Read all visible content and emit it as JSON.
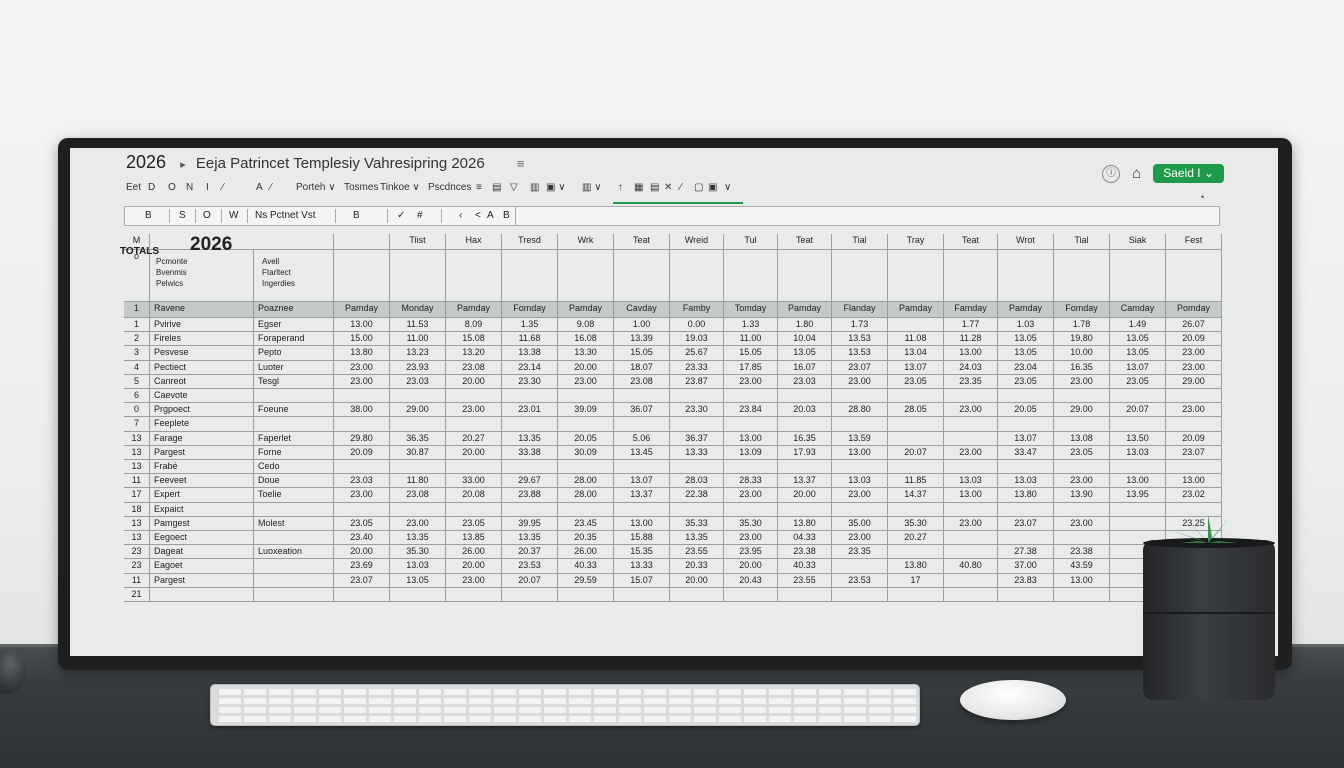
{
  "window": {
    "year": "2026",
    "title": "Eeja Patrincet Templesiy Vahresipring 2026",
    "menu_icon": "≡",
    "share_label": "Saeid I",
    "info_icon": "info-icon",
    "home_icon": "home-icon"
  },
  "ribbon": {
    "items": [
      "Eet",
      "D",
      "O",
      "N",
      "I",
      "⁄",
      "A",
      "⁄",
      "Porteh ∨",
      "Tosmes",
      "Tinkoe ∨",
      "Pscdnces",
      "≡",
      "▤",
      "▽",
      "▥",
      "▣ ∨",
      "▥ ∨",
      "↑",
      "▦",
      "▤",
      "✕",
      "⁄",
      "▢",
      "▣",
      "∨"
    ]
  },
  "formula_bar": {
    "items": [
      "fill",
      "B",
      "S",
      "O",
      "W",
      "Ns Pctnet Vst",
      "B",
      "✓",
      "#",
      "‹",
      "<",
      "A",
      "B"
    ],
    "cell_ref": "M"
  },
  "sheet": {
    "big_year": "2026",
    "totals_label": "TOTALS",
    "corner": "M",
    "row_o": "o",
    "top_headers": [
      "Tiist",
      "Hax",
      "Tresd",
      "Wrk",
      "Teat",
      "Wreid",
      "Tul",
      "Teat",
      "Tial",
      "Tray",
      "Teat",
      "Wrot",
      "Tial",
      "Siak",
      "Fest"
    ],
    "desc_col_a": [
      "Pcmonte",
      "Bvenmis",
      "Pelwics"
    ],
    "desc_col_b": [
      "Avell",
      "Ftarltect",
      "Ingerdies"
    ],
    "day_header": {
      "rn": "1",
      "a": "Ravene",
      "b": "Poaznee",
      "days": [
        "Pamday",
        "Monday",
        "Pamday",
        "Fomday",
        "Pamday",
        "Cavday",
        "Famby",
        "Tomday",
        "Pamday",
        "Flanday",
        "Pamday",
        "Famday",
        "Pamday",
        "Fomday",
        "Camday",
        "Pomday"
      ]
    },
    "rows": [
      {
        "rn": "1",
        "a": "Pvirive",
        "b": "Egser",
        "v": [
          "13.00",
          "11.53",
          "8.09",
          "1.35",
          "9.08",
          "1.00",
          "0.00",
          "1.33",
          "1.80",
          "1.73",
          "",
          "1.77",
          "1.03",
          "1.78",
          "1.49",
          "26.07"
        ]
      },
      {
        "rn": "2",
        "a": "Fireles",
        "b": "Foraperand",
        "v": [
          "15.00",
          "11.00",
          "15.08",
          "11.68",
          "16.08",
          "13.39",
          "19.03",
          "11.00",
          "10.04",
          "13.53",
          "11.08",
          "11.28",
          "13.05",
          "19.80",
          "13.05",
          "20.09"
        ]
      },
      {
        "rn": "3",
        "a": "Pesvese",
        "b": "Pepto",
        "v": [
          "13.80",
          "13.23",
          "13.20",
          "13.38",
          "13.30",
          "15.05",
          "25.67",
          "15.05",
          "13.05",
          "13.53",
          "13.04",
          "13.00",
          "13.05",
          "10.00",
          "13.05",
          "23.00"
        ]
      },
      {
        "rn": "4",
        "a": "Pectiect",
        "b": "Luoter",
        "v": [
          "23.00",
          "23.93",
          "23.08",
          "23.14",
          "20.00",
          "18.07",
          "23.33",
          "17.85",
          "16.07",
          "23.07",
          "13.07",
          "24.03",
          "23.04",
          "16.35",
          "13.07",
          "23.00"
        ]
      },
      {
        "rn": "5",
        "a": "Canreot",
        "b": "Tesgl",
        "v": [
          "23.00",
          "23.03",
          "20.00",
          "23.30",
          "23.00",
          "23.08",
          "23.87",
          "23.00",
          "23.03",
          "23.00",
          "23.05",
          "23.35",
          "23.05",
          "23.00",
          "23.05",
          "29.00"
        ]
      },
      {
        "rn": "6",
        "a": "Caevote",
        "b": "",
        "v": [
          "",
          "",
          "",
          "",
          "",
          "",
          "",
          "",
          "",
          "",
          "",
          "",
          "",
          "",
          "",
          ""
        ]
      },
      {
        "rn": "0",
        "a": "Prgpoect",
        "b": "Foeune",
        "v": [
          "38.00",
          "29.00",
          "23.00",
          "23.01",
          "39.09",
          "36.07",
          "23.30",
          "23.84",
          "20.03",
          "28.80",
          "28.05",
          "23.00",
          "20.05",
          "29.00",
          "20.07",
          "23.00"
        ]
      },
      {
        "rn": "7",
        "a": "Feeplete",
        "b": "",
        "v": [
          "",
          "",
          "",
          "",
          "",
          "",
          "",
          "",
          "",
          "",
          "",
          "",
          "",
          "",
          "",
          ""
        ]
      },
      {
        "rn": "13",
        "a": "Farage",
        "b": "Faperlet",
        "v": [
          "29.80",
          "36.35",
          "20.27",
          "13.35",
          "20.05",
          "5.06",
          "36.37",
          "13.00",
          "16.35",
          "13.59",
          "",
          "",
          "13.07",
          "13.08",
          "13.50",
          "20.09"
        ]
      },
      {
        "rn": "13",
        "a": "Pargest",
        "b": "Forne",
        "v": [
          "20.09",
          "30.87",
          "20.00",
          "33.38",
          "30.09",
          "13.45",
          "13.33",
          "13.09",
          "17.93",
          "13.00",
          "20.07",
          "23.00",
          "33.47",
          "23.05",
          "13.03",
          "23.07"
        ]
      },
      {
        "rn": "13",
        "a": "Frabé",
        "b": "Cedo",
        "v": [
          "",
          "",
          "",
          "",
          "",
          "",
          "",
          "",
          "",
          "",
          "",
          "",
          "",
          "",
          "",
          ""
        ]
      },
      {
        "rn": "11",
        "a": "Feeveet",
        "b": "Doue",
        "v": [
          "23.03",
          "11.80",
          "33.00",
          "29.67",
          "28.00",
          "13.07",
          "28.03",
          "28.33",
          "13.37",
          "13.03",
          "11.85",
          "13.03",
          "13.03",
          "23.00",
          "13.00",
          "13.00"
        ]
      },
      {
        "rn": "17",
        "a": "Expert",
        "b": "Toelie",
        "v": [
          "23.00",
          "23.08",
          "20.08",
          "23.88",
          "28.00",
          "13.37",
          "22.38",
          "23.00",
          "20.00",
          "23.00",
          "14.37",
          "13.00",
          "13.80",
          "13.90",
          "13.95",
          "23.02"
        ]
      },
      {
        "rn": "18",
        "a": "Expaict",
        "b": "",
        "v": [
          "",
          "",
          "",
          "",
          "",
          "",
          "",
          "",
          "",
          "",
          "",
          "",
          "",
          "",
          "",
          ""
        ]
      },
      {
        "rn": "13",
        "a": "Pamgest",
        "b": "Molest",
        "v": [
          "23.05",
          "23.00",
          "23.05",
          "39.95",
          "23.45",
          "13.00",
          "35.33",
          "35.30",
          "13.80",
          "35.00",
          "35.30",
          "23.00",
          "23.07",
          "23.00",
          "",
          "23.25"
        ]
      },
      {
        "rn": "13",
        "a": "Eegoect",
        "b": "",
        "v": [
          "23.40",
          "13.35",
          "13.85",
          "13.35",
          "20.35",
          "15.88",
          "13.35",
          "23.00",
          "04.33",
          "23.00",
          "20.27",
          "",
          "",
          "",
          "",
          ""
        ]
      },
      {
        "rn": "23",
        "a": "Dageat",
        "b": "Luoxeation",
        "v": [
          "20.00",
          "35.30",
          "26.00",
          "20.37",
          "26.00",
          "15.35",
          "23.55",
          "23.95",
          "23.38",
          "23.35",
          "",
          "",
          "27.38",
          "23.38",
          "",
          ""
        ]
      },
      {
        "rn": "23",
        "a": "Eagoet",
        "b": "",
        "v": [
          "23.69",
          "13.03",
          "20.00",
          "23.53",
          "40.33",
          "13.33",
          "20.33",
          "20.00",
          "40.33",
          "",
          "13.80",
          "40.80",
          "37.00",
          "43.59",
          "",
          ""
        ]
      },
      {
        "rn": "11",
        "a": "Pargest",
        "b": "",
        "v": [
          "23.07",
          "13.05",
          "23.00",
          "20.07",
          "29.59",
          "15.07",
          "20.00",
          "20.43",
          "23.55",
          "23.53",
          "17",
          "",
          "23.83",
          "13.00",
          "",
          ""
        ]
      },
      {
        "rn": "21",
        "a": "",
        "b": "",
        "v": [
          "",
          "",
          "",
          "",
          "",
          "",
          "",
          "",
          "",
          "",
          "",
          "",
          "",
          "",
          "",
          ""
        ]
      }
    ]
  }
}
